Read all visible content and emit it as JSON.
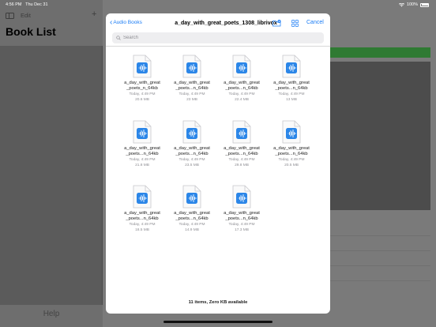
{
  "status": {
    "time": "4:56 PM",
    "date": "Thu Dec 31",
    "battery": "100%"
  },
  "sidebar": {
    "edit_label": "Edit",
    "add_label": "+",
    "title": "Book List",
    "help_label": "Help"
  },
  "picker": {
    "back_label": "Audio Books",
    "title": "a_day_with_great_poets_1308_librivox",
    "cancel_label": "Cancel",
    "search_placeholder": "Search",
    "footer": "11 items, Zero KB available"
  },
  "files": [
    {
      "line1": "a_day_with_great",
      "line2": "_poets_n_64kb",
      "date": "Today, 4:49 PM",
      "size": "20.6 MB"
    },
    {
      "line1": "a_day_with_great",
      "line2": "_poets...n_64kb",
      "date": "Today, 4:49 PM",
      "size": "23 MB"
    },
    {
      "line1": "a_day_with_great",
      "line2": "_poets...n_64kb",
      "date": "Today, 4:49 PM",
      "size": "22.4 MB"
    },
    {
      "line1": "a_day_with_great",
      "line2": "_poets...n_64kb",
      "date": "Today, 4:49 PM",
      "size": "13 MB"
    },
    {
      "line1": "a_day_with_great",
      "line2": "_poets...n_64kb",
      "date": "Today, 4:49 PM",
      "size": "21.8 MB"
    },
    {
      "line1": "a_day_with_great",
      "line2": "_poets...n_64kb",
      "date": "Today, 4:49 PM",
      "size": "23.5 MB"
    },
    {
      "line1": "a_day_with_great",
      "line2": "_poets...n_64kb",
      "date": "Today, 4:49 PM",
      "size": "29.8 MB"
    },
    {
      "line1": "a_day_with_great",
      "line2": "_poets...n_64kb",
      "date": "Today, 4:49 PM",
      "size": "20.5 MB"
    },
    {
      "line1": "a_day_with_great",
      "line2": "_poets...n_64kb",
      "date": "Today, 4:49 PM",
      "size": "18.5 MB"
    },
    {
      "line1": "a_day_with_great",
      "line2": "_poets...n_64kb",
      "date": "Today, 4:49 PM",
      "size": "14.9 MB"
    },
    {
      "line1": "a_day_with_great",
      "line2": "_poets...n_64kb",
      "date": "Today, 4:49 PM",
      "size": "17.3 MB"
    }
  ],
  "icons": {
    "file": "audio-file-icon",
    "folder": "new-folder-icon",
    "grid": "grid-view-icon",
    "search": "search-icon",
    "wifi": "wifi-icon",
    "battery": "battery-icon"
  },
  "colors": {
    "accent": "#1a7cf5",
    "green_bar": "#2f7a33"
  }
}
